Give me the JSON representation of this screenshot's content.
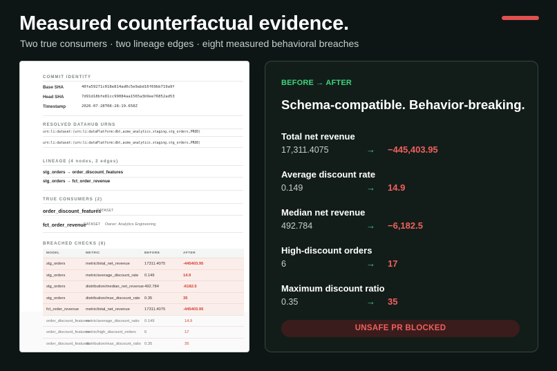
{
  "header": {
    "title": "Measured counterfactual evidence.",
    "subtitle": "Two true consumers · two lineage edges · eight measured behavioral breaches",
    "accent_color": "#e0504f"
  },
  "report": {
    "commit_identity": {
      "heading": "COMMIT IDENTITY",
      "rows": [
        {
          "key": "Base SHA",
          "value": "40fa59271c018e814ad0c5e9abd16f69bb719a9f"
        },
        {
          "key": "Head SHA",
          "value": "7d91d18bfe81cc99084aa1565a3b9ee76852ad53"
        },
        {
          "key": "Timestamp",
          "value": "2026-07-28T08:28:19.658Z"
        }
      ]
    },
    "urns": {
      "heading": "RESOLVED DATAHUB URNS",
      "items": [
        "urn:li:dataset:(urn:li:dataPlatform:dbt,acme_analytics.staging.stg_orders,PROD)",
        "urn:li:dataset:(urn:li:dataPlatform:dbt,acme_analytics.staging.stg_orders,PROD)"
      ]
    },
    "lineage": {
      "heading": "LINEAGE (4 nodes, 2 edges)",
      "edges": [
        "stg_orders → order_discount_features",
        "stg_orders → fct_order_revenue"
      ]
    },
    "consumers": {
      "heading": "TRUE CONSUMERS (2)",
      "items": [
        {
          "name": "order_discount_features",
          "type": "DATASET",
          "owner": ""
        },
        {
          "name": "fct_order_revenue",
          "type": "DATASET",
          "owner": "Owner: Analytics Engineering"
        }
      ]
    },
    "breached": {
      "heading": "BREACHED CHECKS (8)",
      "columns": [
        "MODEL",
        "METRIC",
        "BEFORE",
        "AFTER"
      ],
      "rows": [
        {
          "model": "stg_orders",
          "metric": "metric/total_net_revenue",
          "before": "17311.4075",
          "after": "-445403.95"
        },
        {
          "model": "stg_orders",
          "metric": "metric/average_discount_rate",
          "before": "0.149",
          "after": "14.9"
        },
        {
          "model": "stg_orders",
          "metric": "distribution/median_net_revenue",
          "before": "492.784",
          "after": "-6182.5"
        },
        {
          "model": "stg_orders",
          "metric": "distribution/max_discount_rate",
          "before": "0.35",
          "after": "35"
        },
        {
          "model": "fct_order_revenue",
          "metric": "metric/total_net_revenue",
          "before": "17311.4075",
          "after": "-445403.95"
        },
        {
          "model": "order_discount_features",
          "metric": "metric/average_discount_ratio",
          "before": "0.149",
          "after": "14.9"
        },
        {
          "model": "order_discount_features",
          "metric": "metric/high_discount_orders",
          "before": "6",
          "after": "17"
        },
        {
          "model": "order_discount_features",
          "metric": "distribution/max_discount_ratio",
          "before": "0.35",
          "after": "35"
        }
      ]
    }
  },
  "panel": {
    "kicker": "BEFORE → AFTER",
    "headline": "Schema-compatible. Behavior-breaking.",
    "arrow": "→",
    "metrics": [
      {
        "label": "Total net revenue",
        "before": "17,311.4075",
        "after": "−445,403.95"
      },
      {
        "label": "Average discount rate",
        "before": "0.149",
        "after": "14.9"
      },
      {
        "label": "Median net revenue",
        "before": "492.784",
        "after": "−6,182.5"
      },
      {
        "label": "High-discount orders",
        "before": "6",
        "after": "17"
      },
      {
        "label": "Maximum discount ratio",
        "before": "0.35",
        "after": "35"
      }
    ],
    "status": "UNSAFE PR BLOCKED",
    "colors": {
      "kicker": "#3fd47a",
      "after": "#f0605a",
      "status_bg": "#3a1c1d"
    }
  }
}
